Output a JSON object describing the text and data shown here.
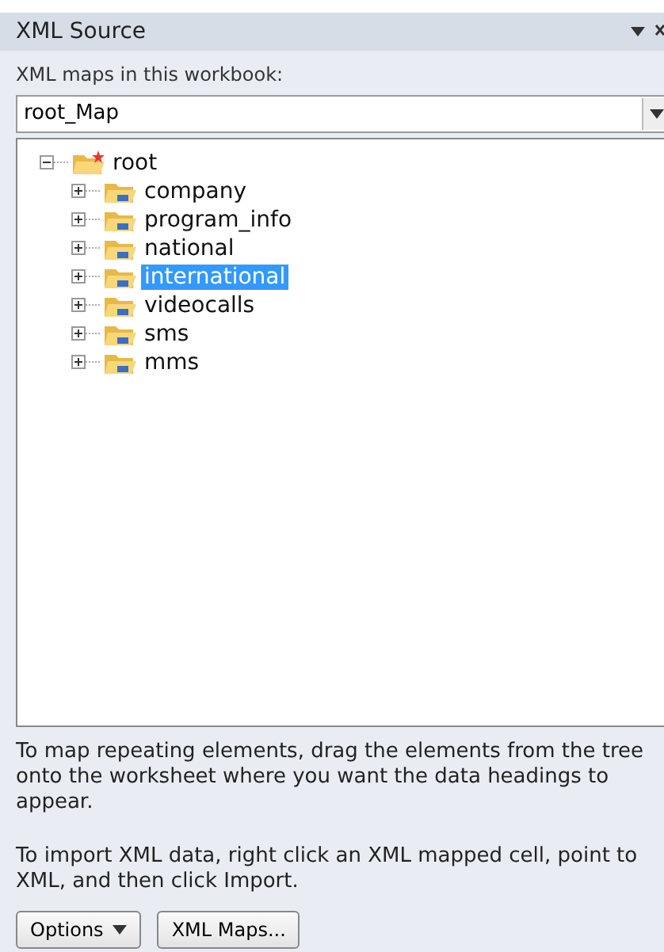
{
  "panel": {
    "title": "XML Source"
  },
  "maps_label": "XML maps in this workbook:",
  "map_select": {
    "value": "root_Map"
  },
  "tree": [
    {
      "label": "root",
      "expanded": true,
      "kind": "root",
      "selected": false,
      "children": [
        {
          "label": "company",
          "expanded": false,
          "kind": "element",
          "selected": false
        },
        {
          "label": "program_info",
          "expanded": false,
          "kind": "element",
          "selected": false
        },
        {
          "label": "national",
          "expanded": false,
          "kind": "element",
          "selected": false
        },
        {
          "label": "international",
          "expanded": false,
          "kind": "element",
          "selected": true
        },
        {
          "label": "videocalls",
          "expanded": false,
          "kind": "element",
          "selected": false
        },
        {
          "label": "sms",
          "expanded": false,
          "kind": "element",
          "selected": false
        },
        {
          "label": "mms",
          "expanded": false,
          "kind": "element",
          "selected": false
        }
      ]
    }
  ],
  "help": [
    "To map repeating elements, drag the elements from the tree onto the worksheet where you want the data headings to appear.",
    "To import XML data, right click an XML mapped cell, point to XML, and then click Import."
  ],
  "buttons": [
    {
      "label": "Options",
      "kind": "menu"
    },
    {
      "label": "XML Maps...",
      "kind": "plain"
    }
  ]
}
